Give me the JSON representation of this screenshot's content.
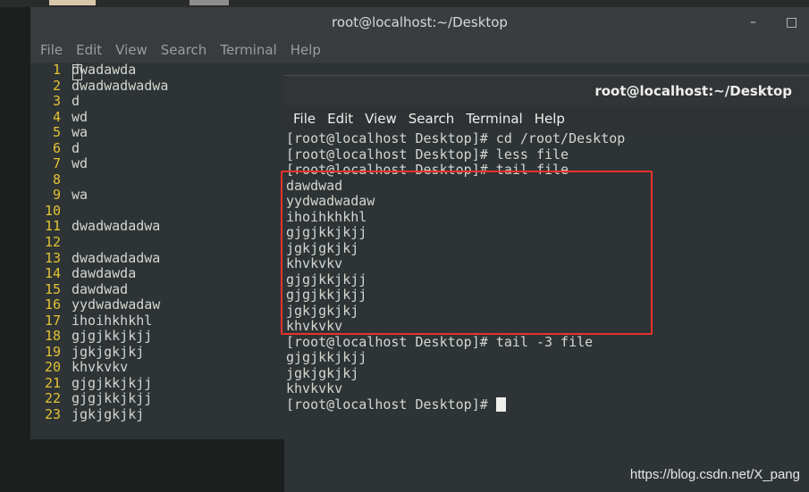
{
  "back_window": {
    "title": "root@localhost:~/Desktop",
    "minimize": "–",
    "maximize": "□",
    "menu": [
      "File",
      "Edit",
      "View",
      "Search",
      "Terminal",
      "Help"
    ],
    "lines": [
      {
        "n": "1",
        "t": "dwadawda"
      },
      {
        "n": "2",
        "t": "dwadwadwadwa"
      },
      {
        "n": "3",
        "t": "d"
      },
      {
        "n": "4",
        "t": "wd"
      },
      {
        "n": "5",
        "t": "wa"
      },
      {
        "n": "6",
        "t": "d"
      },
      {
        "n": "7",
        "t": "wd"
      },
      {
        "n": "8",
        "t": ""
      },
      {
        "n": "9",
        "t": "wa"
      },
      {
        "n": "10",
        "t": ""
      },
      {
        "n": "11",
        "t": "dwadwadadwa"
      },
      {
        "n": "12",
        "t": ""
      },
      {
        "n": "13",
        "t": "dwadwadadwa"
      },
      {
        "n": "14",
        "t": "dawdawda"
      },
      {
        "n": "15",
        "t": "dawdwad"
      },
      {
        "n": "16",
        "t": "yydwadwadaw"
      },
      {
        "n": "17",
        "t": "ihoihkhkhl"
      },
      {
        "n": "18",
        "t": "gjgjkkjkjj"
      },
      {
        "n": "19",
        "t": "jgkjgkjkj"
      },
      {
        "n": "20",
        "t": "khvkvkv"
      },
      {
        "n": "21",
        "t": "gjgjkkjkjj"
      },
      {
        "n": "22",
        "t": "gjgjkkjkjj"
      },
      {
        "n": "23",
        "t": "jgkjgkjkj"
      }
    ]
  },
  "front_window": {
    "title": "root@localhost:~/Desktop",
    "menu": [
      "File",
      "Edit",
      "View",
      "Search",
      "Terminal",
      "Help"
    ],
    "lines": [
      "[root@localhost Desktop]# cd /root/Desktop",
      "[root@localhost Desktop]# less file",
      "[root@localhost Desktop]# tail file",
      "dawdwad",
      "yydwadwadaw",
      "ihoihkhkhl",
      "gjgjkkjkjj",
      "jgkjgkjkj",
      "khvkvkv",
      "gjgjkkjkjj",
      "gjgjkkjkjj",
      "jgkjgkjkj",
      "khvkvkv",
      "[root@localhost Desktop]# tail -3 file",
      "gjgjkkjkjj",
      "jgkjgkjkj",
      "khvkvkv"
    ],
    "prompt": "[root@localhost Desktop]# "
  },
  "watermark": "https://blog.csdn.net/X_pang",
  "colors": {
    "highlight": "#e8322c",
    "line_number": "#e4c233",
    "terminal_bg": "#2e3436"
  }
}
